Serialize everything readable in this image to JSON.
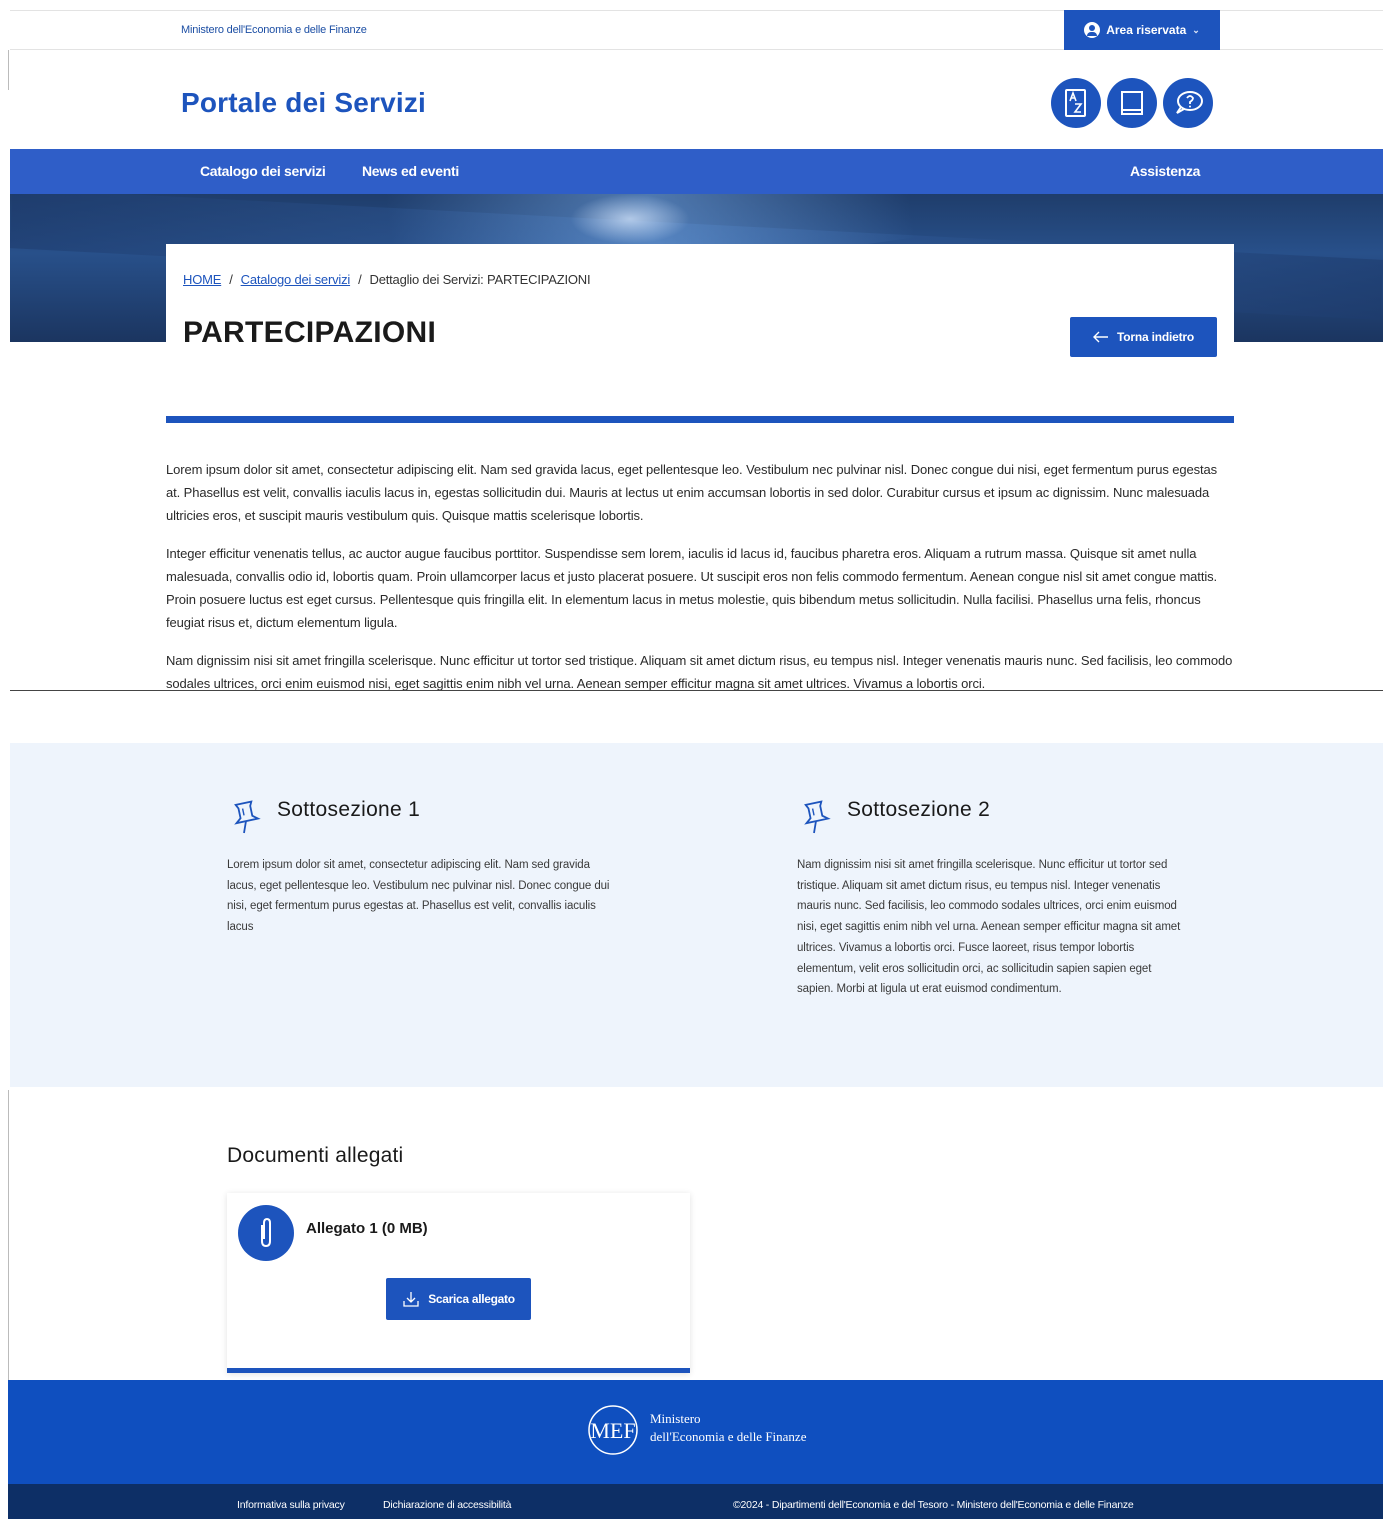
{
  "topbar": {
    "ministry": "Ministero dell'Economia e delle Finanze",
    "area_label": "Area riservata"
  },
  "header": {
    "title": "Portale dei Servizi",
    "icons": [
      "az-dictionary-icon",
      "book-icon",
      "help-chat-icon"
    ]
  },
  "nav": {
    "catalog": "Catalogo dei servizi",
    "news": "News ed eventi",
    "assist": "Assistenza"
  },
  "breadcrumb": {
    "home": "HOME",
    "catalog": "Catalogo dei servizi",
    "current": "Dettaglio dei Servizi: PARTECIPAZIONI",
    "separator": "/"
  },
  "page": {
    "title": "PARTECIPAZIONI",
    "back_label": "Torna indietro",
    "paragraphs": [
      "Lorem ipsum dolor sit amet, consectetur adipiscing elit. Nam sed gravida lacus, eget pellentesque leo. Vestibulum nec pulvinar nisl. Donec congue dui nisi, eget fermentum purus egestas at. Phasellus est velit, convallis iaculis lacus in, egestas sollicitudin dui. Mauris at lectus ut enim accumsan lobortis in sed dolor. Curabitur cursus et ipsum ac dignissim. Nunc malesuada ultricies eros, et suscipit mauris vestibulum quis. Quisque mattis scelerisque lobortis.",
      "Integer efficitur venenatis tellus, ac auctor augue faucibus porttitor. Suspendisse sem lorem, iaculis id lacus id, faucibus pharetra eros. Aliquam a rutrum massa. Quisque sit amet nulla malesuada, convallis odio id, lobortis quam. Proin ullamcorper lacus et justo placerat posuere. Ut suscipit eros non felis commodo fermentum. Aenean congue nisl sit amet congue mattis. Proin posuere luctus est eget cursus. Pellentesque quis fringilla elit. In elementum lacus in metus molestie, quis bibendum metus sollicitudin. Nulla facilisi. Phasellus urna felis, rhoncus feugiat risus et, dictum elementum ligula.",
      "Nam dignissim nisi sit amet fringilla scelerisque. Nunc efficitur ut tortor sed tristique. Aliquam sit amet dictum risus, eu tempus nisl. Integer venenatis mauris nunc. Sed facilisis, leo commodo sodales ultrices, orci enim euismod nisi, eget sagittis enim nibh vel urna. Aenean semper efficitur magna sit amet ultrices. Vivamus a lobortis orci."
    ]
  },
  "subsections": [
    {
      "title": "Sottosezione 1",
      "text": "Lorem ipsum dolor sit amet, consectetur adipiscing elit. Nam sed gravida lacus, eget pellentesque leo. Vestibulum nec pulvinar nisl. Donec congue dui nisi, eget fermentum purus egestas at. Phasellus est velit, convallis iaculis lacus"
    },
    {
      "title": "Sottosezione 2",
      "text": "Nam dignissim nisi sit amet fringilla scelerisque. Nunc efficitur ut tortor sed tristique. Aliquam sit amet dictum risus, eu tempus nisl. Integer venenatis mauris nunc. Sed facilisis, leo commodo sodales ultrices, orci enim euismod nisi, eget sagittis enim nibh vel urna. Aenean semper efficitur magna sit amet ultrices. Vivamus a lobortis orci. Fusce laoreet, risus tempor lobortis elementum, velit eros sollicitudin orci, ac sollicitudin sapien sapien eget sapien. Morbi at ligula ut erat euismod condimentum."
    }
  ],
  "documents": {
    "title": "Documenti allegati",
    "items": [
      {
        "name": "Allegato 1 (0 MB)",
        "download_label": "Scarica allegato"
      }
    ]
  },
  "footer": {
    "logo_text": "MEF",
    "ministry_line1": "Ministero",
    "ministry_line2": "dell'Economia e delle Finanze",
    "privacy": "Informativa sulla privacy",
    "accessibility": "Dichiarazione di accessibilità",
    "copyright": "©2024 - Dipartimenti dell'Economia e del Tesoro - Ministero dell'Economia e delle Finanze"
  },
  "colors": {
    "primary": "#1d54bd",
    "nav": "#2f5ec8",
    "subsection_bg": "#eef4fc",
    "footer_top": "#0f4fbf",
    "footer_bottom": "#0d2f66"
  }
}
